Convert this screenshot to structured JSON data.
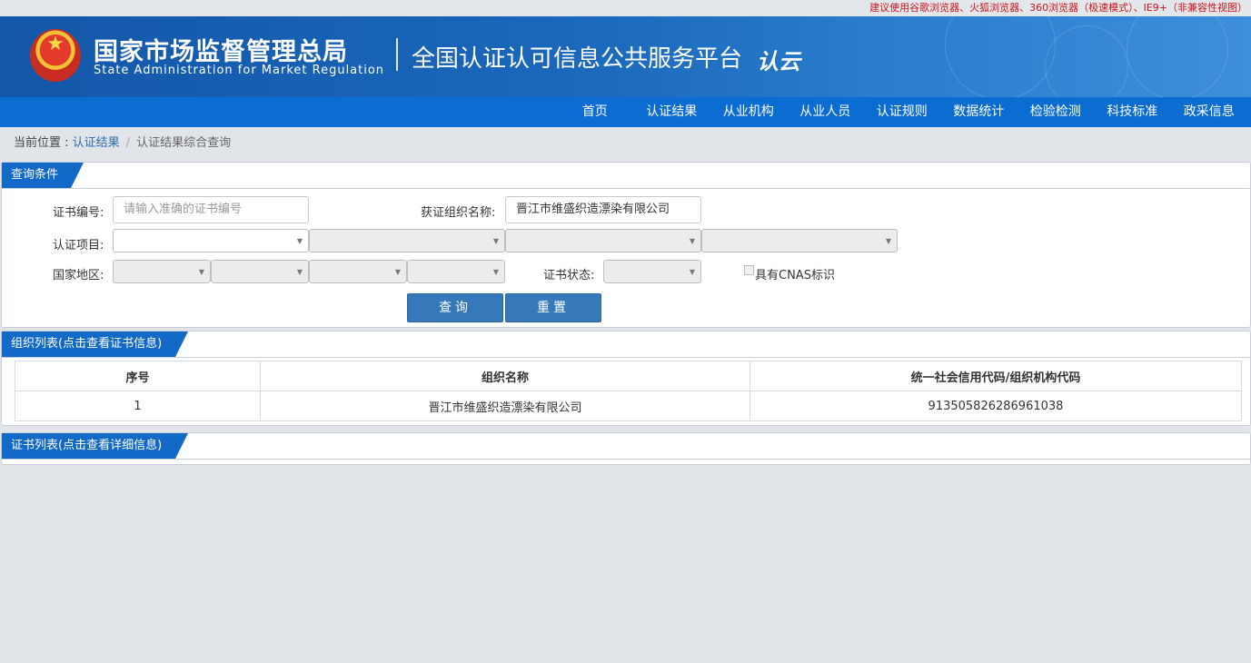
{
  "top_notice": "建议使用谷歌浏览器、火狐浏览器、360浏览器（极速模式）、IE9+（非兼容性视图）",
  "header": {
    "org_name_cn": "国家市场监督管理总局",
    "org_name_en": "State Administration  for  Market Regulation",
    "platform_title": "全国认证认可信息公共服务平台",
    "logo_mark": "认云"
  },
  "nav": {
    "items": [
      "首页",
      "认证结果",
      "从业机构",
      "从业人员",
      "认证规则",
      "数据统计",
      "检验检测",
      "科技标准",
      "政采信息"
    ]
  },
  "breadcrumb": {
    "prefix": "当前位置 : ",
    "link": "认证结果",
    "separator": "/",
    "current": "认证结果综合查询"
  },
  "query": {
    "section_title": "查询条件",
    "cert_no_label": "证书编号:",
    "cert_no_placeholder": "请输入准确的证书编号",
    "org_name_label": "获证组织名称:",
    "org_name_value": "晋江市维盛织造漂染有限公司",
    "project_label": "认证项目:",
    "region_label": "国家地区:",
    "status_label": "证书状态:",
    "cnas_label": "具有CNAS标识",
    "search_button": "查询",
    "reset_button": "重置"
  },
  "org_list": {
    "section_title": "组织列表(点击查看证书信息)",
    "columns": [
      "序号",
      "组织名称",
      "统一社会信用代码/组织机构代码"
    ],
    "rows": [
      [
        "1",
        "晋江市维盛织造漂染有限公司",
        "913505826286961038"
      ]
    ]
  },
  "cert_list": {
    "section_title": "证书列表(点击查看详细信息)"
  },
  "colors": {
    "nav_blue": "#0b6cd2",
    "tag_blue": "#1269c7",
    "button_blue": "#3679b8",
    "notice_red": "#c8161d"
  }
}
